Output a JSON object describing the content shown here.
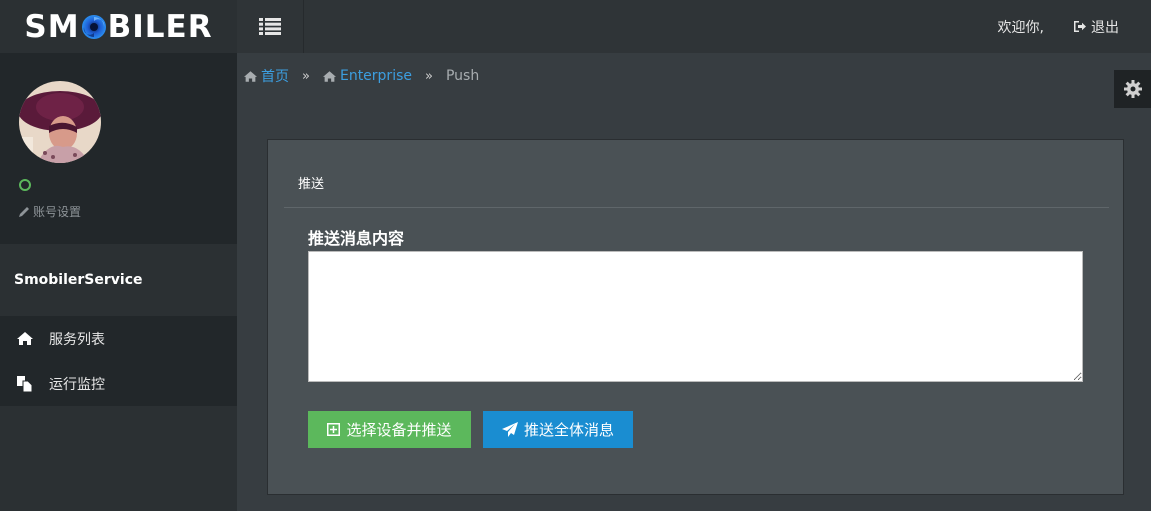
{
  "header": {
    "logo_prefix": "SM",
    "logo_suffix": "BILER",
    "welcome": "欢迎你,",
    "logout": "退出"
  },
  "sidebar": {
    "account_settings": "账号设置",
    "service_name": "SmobilerService",
    "items": [
      {
        "label": "服务列表",
        "icon": "home-icon"
      },
      {
        "label": "运行监控",
        "icon": "copy-icon"
      }
    ]
  },
  "breadcrumb": {
    "home": "首页",
    "enterprise": "Enterprise",
    "current": "Push",
    "separator": "»"
  },
  "panel": {
    "title": "推送",
    "field_label": "推送消息内容",
    "textarea_value": "",
    "btn_select_push": "选择设备并推送",
    "btn_push_all": "推送全体消息"
  },
  "colors": {
    "accent_green": "#5cb85c",
    "accent_blue": "#1a8dd1",
    "link": "#3c9ee0",
    "status_online": "#5cb85c"
  }
}
